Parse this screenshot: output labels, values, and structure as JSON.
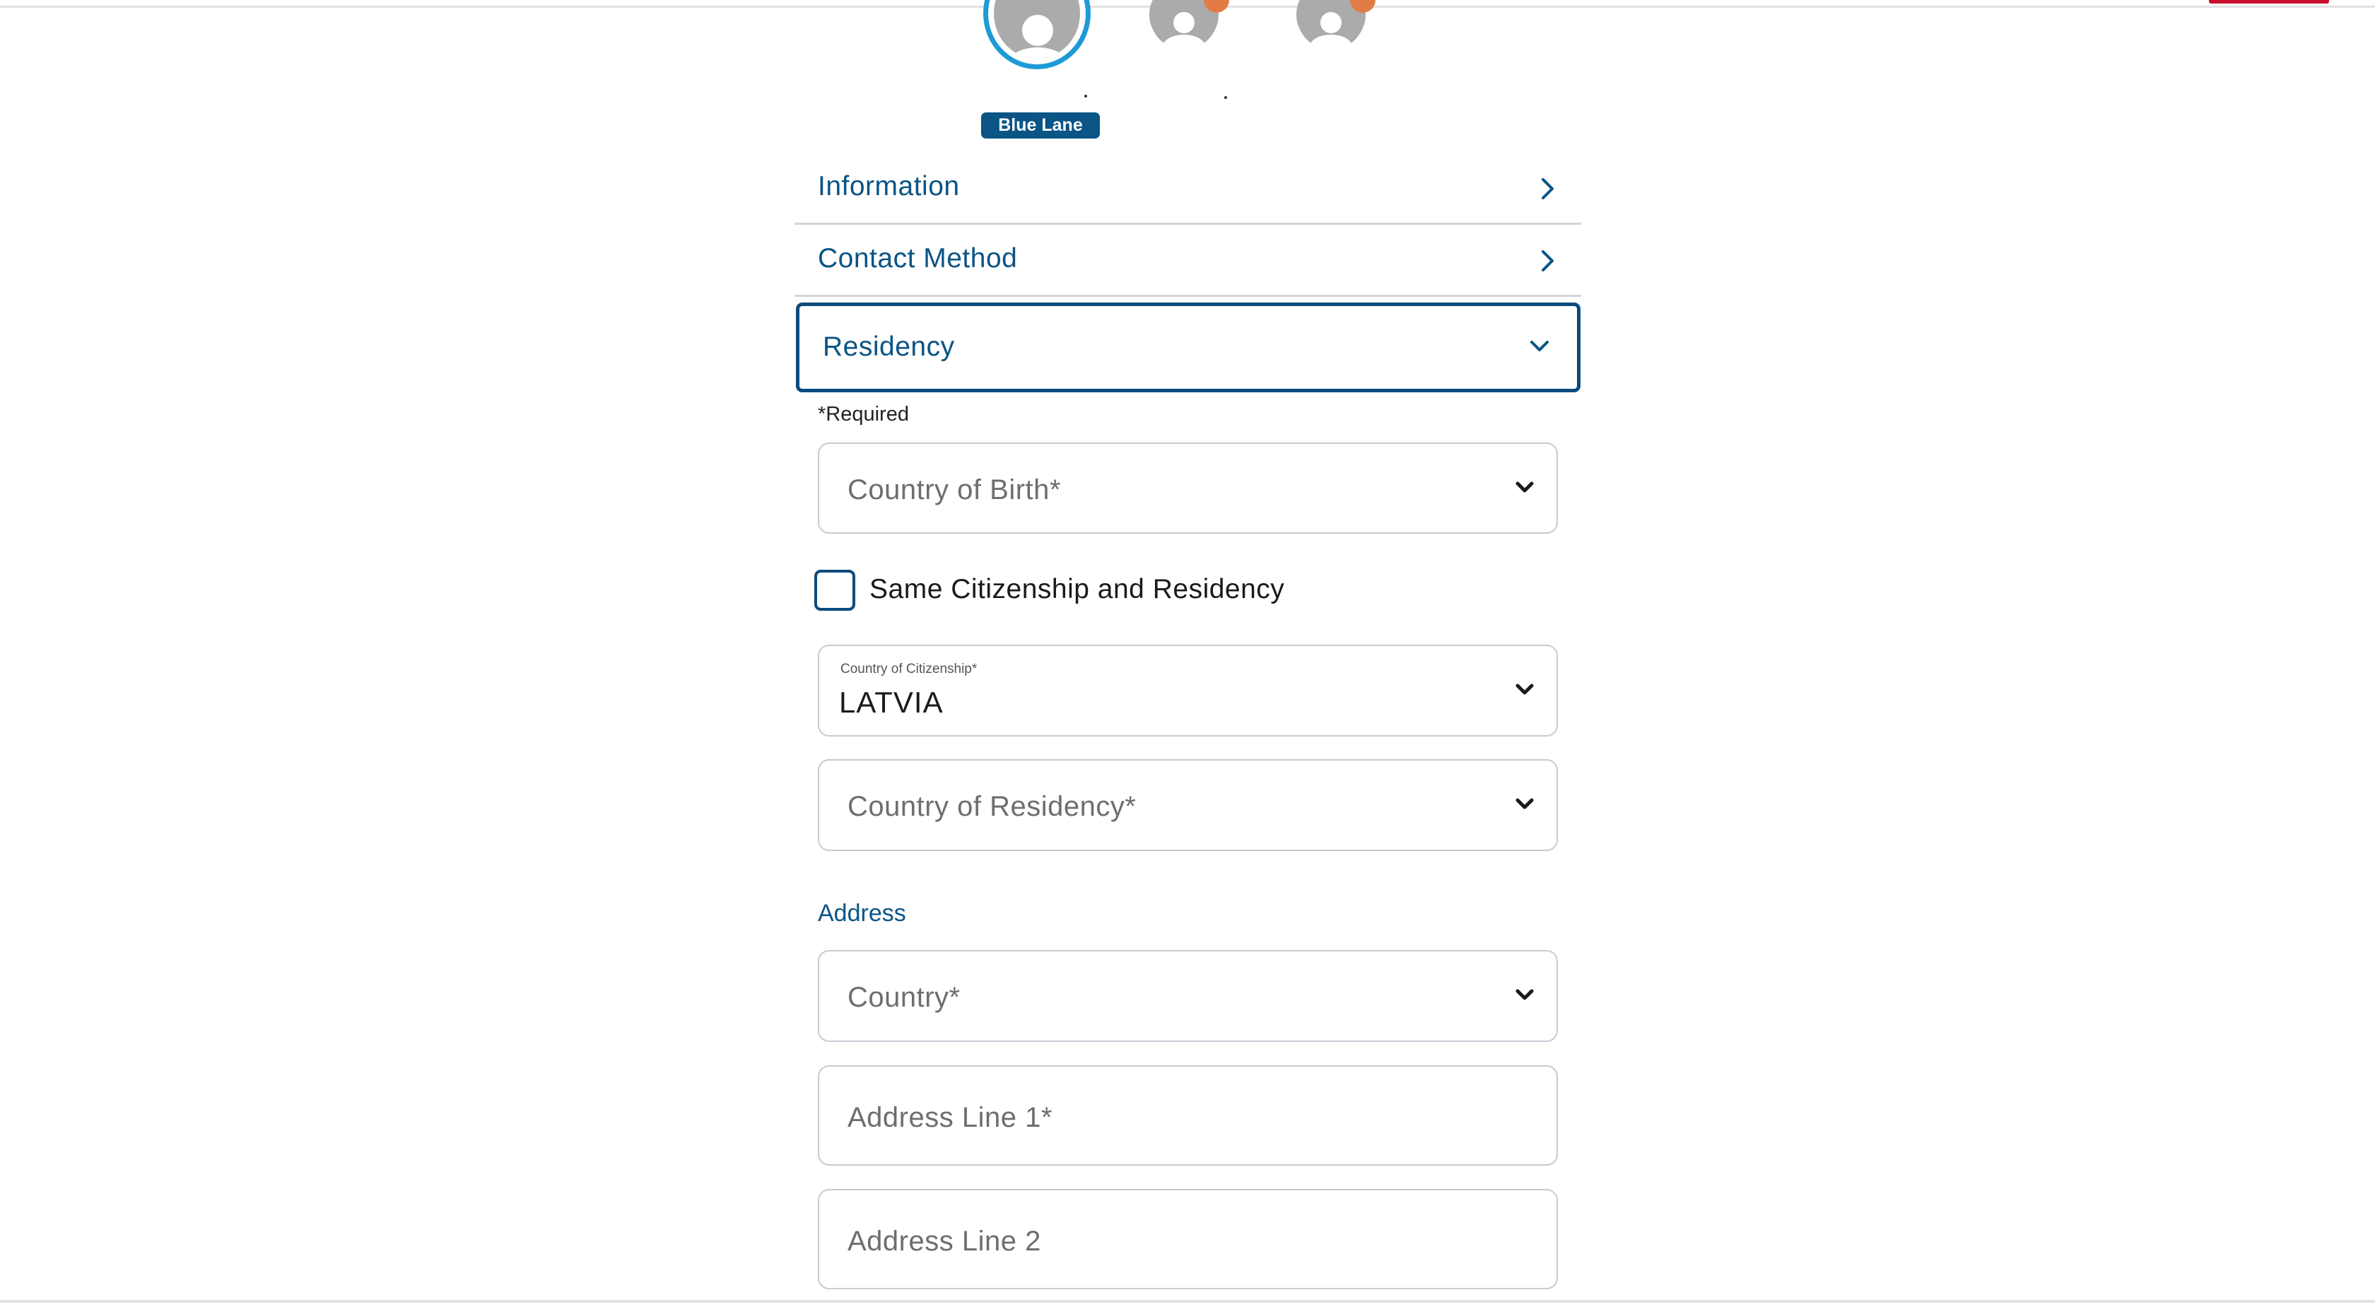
{
  "header": {
    "accent_color": "#c8102e"
  },
  "travelers": {
    "lane_badge": "Blue Lane",
    "selected_ring_color": "#1e9ad6",
    "notification_color": "#e27c47"
  },
  "accordion": {
    "information": "Information",
    "contact_method": "Contact Method",
    "residency": "Residency"
  },
  "form": {
    "required_note": "*Required",
    "country_of_birth_placeholder": "Country of Birth*",
    "same_citizenship_label": "Same Citizenship and Residency",
    "same_citizenship_checked": false,
    "citizenship_label": "Country of Citizenship*",
    "citizenship_value": "LATVIA",
    "residency_placeholder": "Country of Residency*",
    "address_section_title": "Address",
    "country_placeholder": "Country*",
    "address_line1_placeholder": "Address Line 1*",
    "address_line2_placeholder": "Address Line 2"
  },
  "colors": {
    "brand_blue": "#0a5486",
    "focus_border": "#0a4b7d",
    "field_border": "#c6ccd3"
  }
}
